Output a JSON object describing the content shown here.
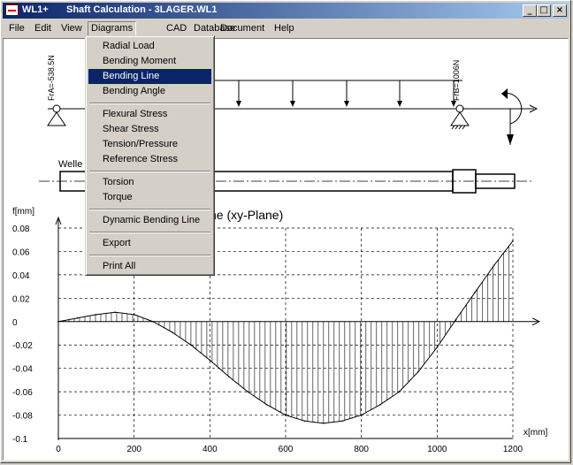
{
  "title": {
    "app": "WL1+",
    "doc": "Shaft Calculation  -  3LAGER.WL1"
  },
  "window_buttons": {
    "minimize": "_",
    "maximize": "□",
    "close": "×"
  },
  "menu": [
    "File",
    "Edit",
    "View",
    "Diagrams",
    "CAD",
    "Database",
    "Document",
    "Help"
  ],
  "diagrams_menu": {
    "groups": [
      [
        "Radial Load",
        "Bending Moment",
        "Bending Line",
        "Bending Angle"
      ],
      [
        "Flexural Stress",
        "Shear Stress",
        "Tension/Pressure",
        "Reference Stress"
      ],
      [
        "Torsion",
        "Torque"
      ],
      [
        "Dynamic Bending Line"
      ],
      [
        "Export"
      ],
      [
        "Print All"
      ]
    ],
    "selected": "Bending Line"
  },
  "drawing": {
    "left_bearing_force": "FrA=-538.5N",
    "right_bearing_force": "FrB=1006N",
    "shaft_label": "Welle"
  },
  "chart_data": {
    "type": "area",
    "title": "Bending Line (xy-Plane)",
    "title_visible_fragment": "ne (xy-Plane)",
    "ylabel": "f[mm]",
    "xlabel": "x[mm]",
    "x_ticks": [
      0,
      200,
      400,
      600,
      800,
      1000,
      1200
    ],
    "y_ticks": [
      0.08,
      0.06,
      0.04,
      0.02,
      0,
      -0.02,
      -0.04,
      -0.06,
      -0.08,
      -0.1
    ],
    "y_tick_labels": [
      "0.08",
      "0.06",
      "0.04",
      "0.02",
      "0",
      "-0.02",
      "-0.04",
      "-0.06",
      "-0.08",
      "-0.1"
    ],
    "xlim": [
      0,
      1200
    ],
    "ylim": [
      -0.1,
      0.08
    ],
    "grid": true,
    "series": [
      {
        "x": [
          0,
          50,
          100,
          150,
          200,
          250,
          300,
          350,
          400,
          450,
          500,
          550,
          600,
          650,
          700,
          750,
          800,
          850,
          900,
          950,
          1000,
          1050,
          1100,
          1150,
          1200
        ],
        "y": [
          0,
          0.003,
          0.006,
          0.008,
          0.006,
          0,
          -0.009,
          -0.02,
          -0.033,
          -0.047,
          -0.06,
          -0.071,
          -0.08,
          -0.085,
          -0.087,
          -0.085,
          -0.08,
          -0.071,
          -0.06,
          -0.043,
          -0.022,
          0.002,
          0.025,
          0.048,
          0.069
        ]
      }
    ],
    "hatch_color": "#000000"
  }
}
